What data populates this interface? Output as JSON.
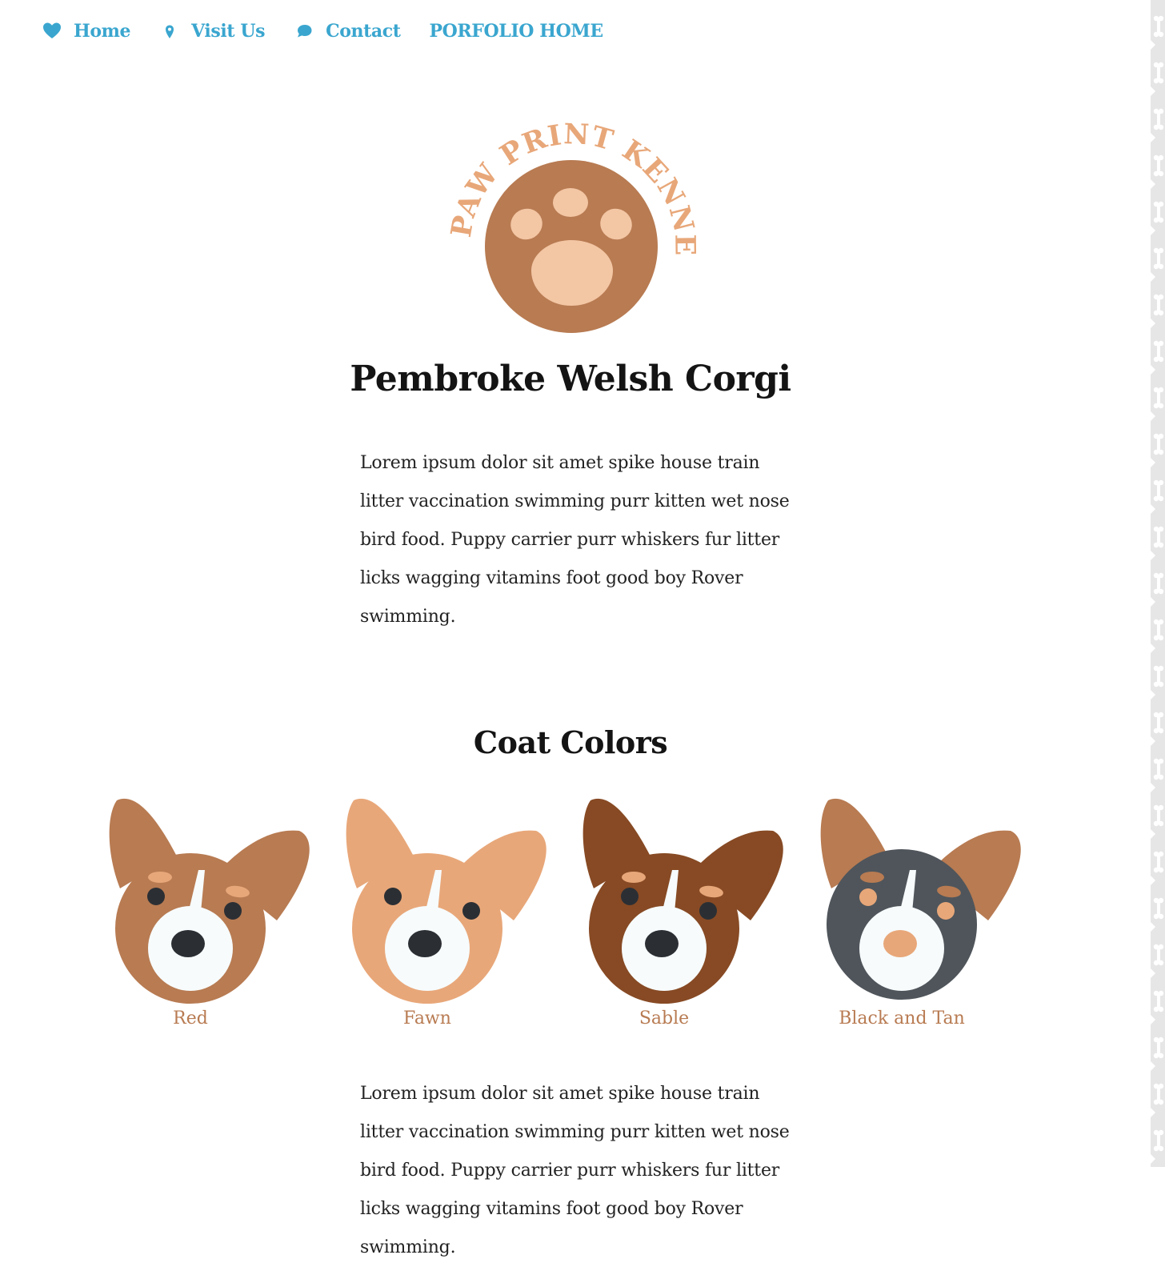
{
  "nav": {
    "items": [
      {
        "label": "Home",
        "icon": "heart-icon"
      },
      {
        "label": "Visit Us",
        "icon": "map-pin-icon"
      },
      {
        "label": "Contact",
        "icon": "chat-bubble-icon"
      },
      {
        "label": "PORFOLIO HOME",
        "icon": ""
      }
    ]
  },
  "brand": {
    "arc_text": "PAW PRINT KENNELS",
    "logo_icon": "paw-print-icon"
  },
  "main": {
    "title": "Pembroke Welsh Corgi",
    "intro": "Lorem ipsum dolor sit amet spike house train litter vaccination swimming purr kitten wet nose bird food. Puppy carrier purr whiskers fur litter licks wagging vitamins foot good boy Rover swimming.",
    "coat_title": "Coat Colors",
    "coats": [
      {
        "label": "Red",
        "icon": "corgi-red-icon"
      },
      {
        "label": "Fawn",
        "icon": "corgi-fawn-icon"
      },
      {
        "label": "Sable",
        "icon": "corgi-sable-icon"
      },
      {
        "label": "Black and Tan",
        "icon": "corgi-black-and-tan-icon"
      }
    ],
    "outro": "Lorem ipsum dolor sit amet spike house train litter vaccination swimming purr kitten wet nose bird food. Puppy carrier purr whiskers fur litter licks wagging vitamins foot good boy Rover swimming."
  },
  "colors": {
    "accent": "#3aa6cf",
    "brand_brown": "#b87b52",
    "brand_tan": "#e8a779",
    "paw_pad": "#f3c6a4",
    "sable": "#874a24",
    "black_and_tan": "#4f555b",
    "muzzle": "#f7fbfc",
    "nose": "#2b2f34"
  }
}
